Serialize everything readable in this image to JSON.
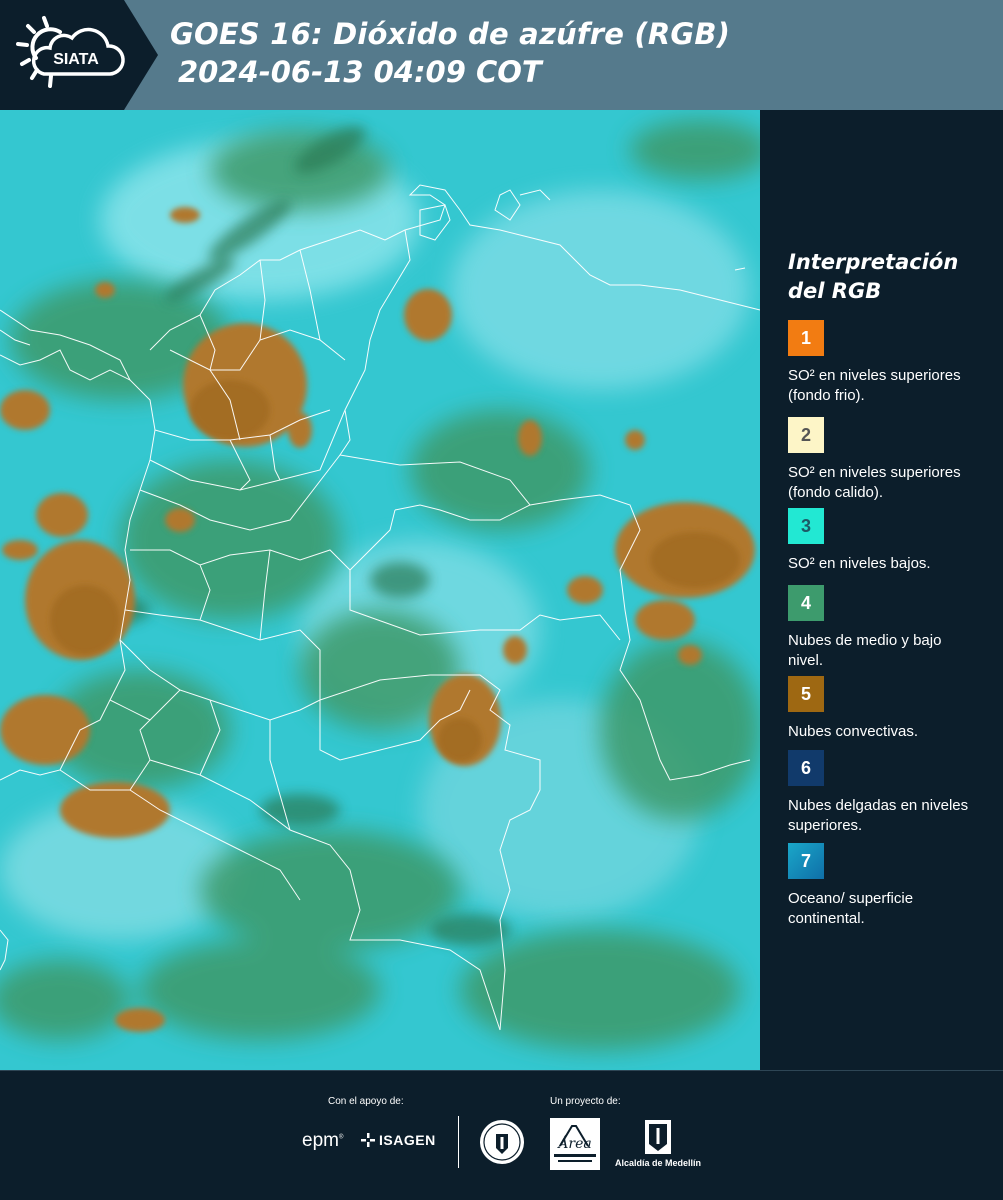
{
  "header": {
    "logo_text": "SIATA",
    "title": "GOES 16: Dióxido de azúfre (RGB)",
    "subtitle": "2024-06-13 04:09 COT",
    "band_color": "#557a8c",
    "background_color": "#0c1e2b"
  },
  "map": {
    "product": "GOES 16 SO2 RGB",
    "ocean_land_color": "#2fc6cf",
    "convective_cloud_color": "#b07a2e",
    "mid_low_cloud_color": "#3f9a6a",
    "border_color": "#ffffff"
  },
  "legend": {
    "title": "Interpretación del RGB",
    "items": [
      {
        "number": "1",
        "color": "#f27c12",
        "text_color": "#ffffff",
        "description": "SO² en niveles superiores (fondo frio)."
      },
      {
        "number": "2",
        "color": "#fdf5c7",
        "text_color": "#555555",
        "description": "SO² en niveles superiores (fondo calido)."
      },
      {
        "number": "3",
        "color": "#22e8d3",
        "text_color": "#1d5a66",
        "description": "SO² en niveles bajos."
      },
      {
        "number": "4",
        "color": "#3d9b6d",
        "text_color": "#ffffff",
        "description": "Nubes de medio y bajo nivel."
      },
      {
        "number": "5",
        "color": "#9e6812",
        "text_color": "#ffffff",
        "description": "Nubes convectivas."
      },
      {
        "number": "6",
        "color": "#113a6b",
        "text_color": "#ffffff",
        "description": "Nubes delgadas en niveles superiores."
      },
      {
        "number": "7",
        "color": "#168ebf",
        "text_color": "#ffffff",
        "description": "Oceano/ superficie continental."
      }
    ]
  },
  "footer": {
    "support_label": "Con el apoyo de:",
    "project_label": "Un proyecto de:",
    "sponsor_1": "epm",
    "sponsor_2": "ISAGEN",
    "partner_area": "Área Metropolitana",
    "partner_alcaldia": "Alcaldía de Medellín"
  }
}
